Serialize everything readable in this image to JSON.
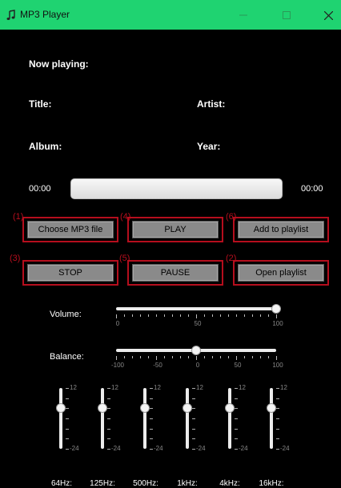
{
  "window": {
    "title": "MP3 Player",
    "accent": "#1fd371",
    "highlight": "#b50e1d"
  },
  "info": {
    "now_playing": "Now playing:",
    "title": "Title:",
    "artist": "Artist:",
    "album": "Album:",
    "year": "Year:"
  },
  "progress": {
    "elapsed": "00:00",
    "total": "00:00"
  },
  "buttons": {
    "choose": {
      "label": "Choose MP3 file",
      "marker": "(1)"
    },
    "play": {
      "label": "PLAY",
      "marker": "(4)"
    },
    "add": {
      "label": "Add to playlist",
      "marker": "(6)"
    },
    "stop": {
      "label": "STOP",
      "marker": "(3)"
    },
    "pause": {
      "label": "PAUSE",
      "marker": "(5)"
    },
    "open": {
      "label": "Open playlist",
      "marker": "(2)"
    }
  },
  "volume": {
    "label": "Volume:",
    "value": 100,
    "min": 0,
    "max": 100,
    "ticks": [
      "0",
      "50",
      "100"
    ]
  },
  "balance": {
    "label": "Balance:",
    "value": 0,
    "min": -100,
    "max": 100,
    "ticks": [
      "-100",
      "-50",
      "0",
      "50",
      "100"
    ]
  },
  "equalizer": {
    "max_label": "12",
    "min_label": "-24",
    "bands": [
      {
        "label": "64Hz:",
        "value": 0
      },
      {
        "label": "125Hz:",
        "value": 0
      },
      {
        "label": "500Hz:",
        "value": 0
      },
      {
        "label": "1kHz:",
        "value": 0
      },
      {
        "label": "4kHz:",
        "value": 0
      },
      {
        "label": "16kHz:",
        "value": 0
      }
    ]
  }
}
